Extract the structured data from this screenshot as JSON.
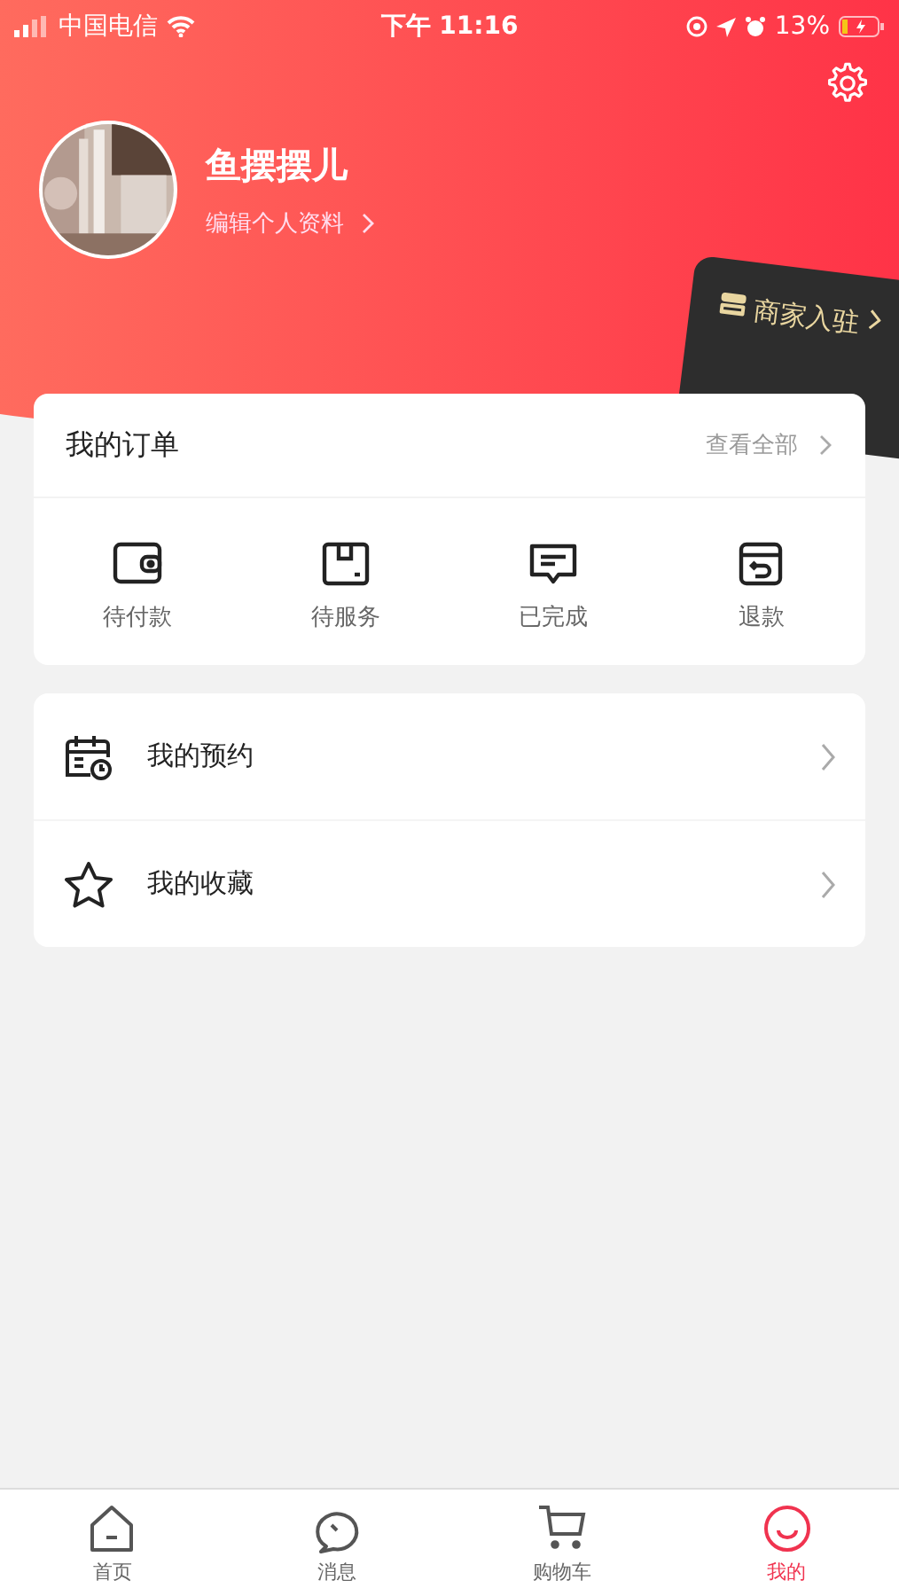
{
  "status_bar": {
    "carrier": "中国电信",
    "time": "下午 11:16",
    "battery": "13%"
  },
  "profile": {
    "name": "鱼摆摆儿",
    "edit_link": "编辑个人资料"
  },
  "merchant_badge": {
    "label": "商家入驻"
  },
  "orders": {
    "title": "我的订单",
    "view_all": "查看全部",
    "items": [
      {
        "kind": "wallet",
        "label": "待付款"
      },
      {
        "kind": "box",
        "label": "待服务"
      },
      {
        "kind": "message",
        "label": "已完成"
      },
      {
        "kind": "refund",
        "label": "退款"
      }
    ]
  },
  "menu": [
    {
      "kind": "calendar",
      "label": "我的预约"
    },
    {
      "kind": "star",
      "label": "我的收藏"
    }
  ],
  "tab_bar": [
    {
      "kind": "home",
      "label": "首页",
      "selected": false
    },
    {
      "kind": "chat",
      "label": "消息",
      "selected": false
    },
    {
      "kind": "cart",
      "label": "购物车",
      "selected": false
    },
    {
      "kind": "smile",
      "label": "我的",
      "selected": true
    }
  ]
}
